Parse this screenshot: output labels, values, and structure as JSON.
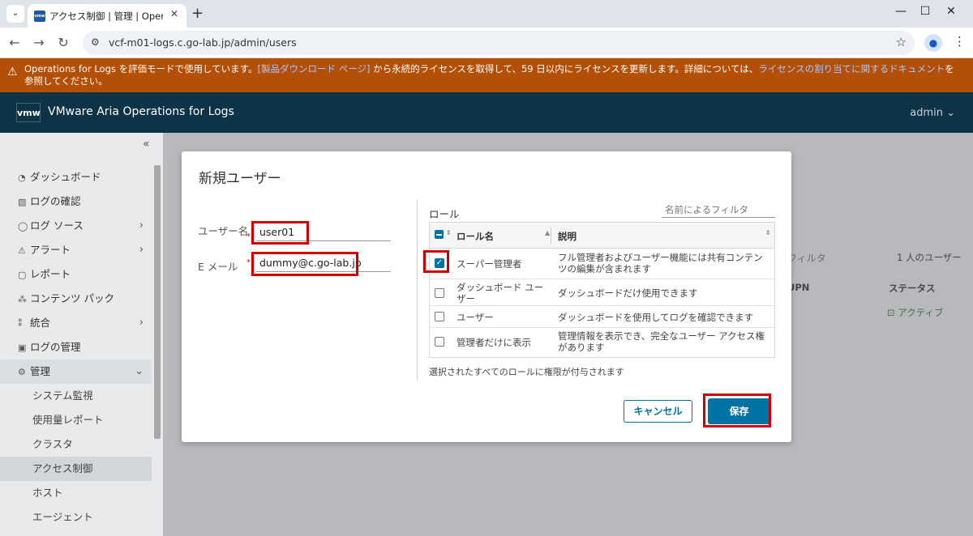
{
  "browser": {
    "tab_title": "アクセス制御 | 管理 | Operations",
    "tab_favicon": "vmw",
    "url": "vcf-m01-logs.c.go-lab.jp/admin/users"
  },
  "banner": {
    "text_1": "Operations for Logs を評価モードで使用しています。",
    "link_1": "[製品ダウンロード ページ]",
    "text_2": " から永続的ライセンスを取得して、59 日以内にライセンスを更新します。詳細については、",
    "link_2": "ライセンスの割り当てに関するドキュメント",
    "text_3": "を参照してください。"
  },
  "header": {
    "logo": "vmw",
    "title": "VMware Aria Operations for Logs",
    "user": "admin"
  },
  "sidebar": {
    "items": [
      {
        "label": "ダッシュボード",
        "icon": "dashboard-icon"
      },
      {
        "label": "ログの確認",
        "icon": "log-icon"
      },
      {
        "label": "ログ ソース",
        "icon": "source-icon"
      },
      {
        "label": "アラート",
        "icon": "alert-icon"
      },
      {
        "label": "レポート",
        "icon": "report-icon"
      },
      {
        "label": "コンテンツ パック",
        "icon": "content-pack-icon"
      },
      {
        "label": "統合",
        "icon": "integration-icon"
      },
      {
        "label": "ログの管理",
        "icon": "log-management-icon"
      },
      {
        "label": "管理",
        "icon": "gear-icon"
      }
    ],
    "subitems": [
      "システム監視",
      "使用量レポート",
      "クラスタ",
      "アクセス制御",
      "ホスト",
      "エージェント"
    ]
  },
  "background": {
    "filter_placeholder": "フィルタ",
    "user_count": "1 人のユーザー",
    "col_upn": "UPN",
    "col_status": "ステータス",
    "status_value": "アクティブ"
  },
  "modal": {
    "title": "新規ユーザー",
    "username_label": "ユーザー名",
    "username_value": "user01",
    "email_label": "E メール",
    "email_value": "dummy@c.go-lab.jp",
    "roles_label": "ロール",
    "role_filter_placeholder": "名前によるフィルタ",
    "col_role_name": "ロール名",
    "col_description": "説明",
    "roles": [
      {
        "name": "スーパー管理者",
        "description": "フル管理者およびユーザー機能には共有コンテンツの編集が含まれます",
        "checked": true
      },
      {
        "name": "ダッシュボード ユーザー",
        "description": "ダッシュボードだけ使用できます",
        "checked": false
      },
      {
        "name": "ユーザー",
        "description": "ダッシュボードを使用してログを確認できます",
        "checked": false
      },
      {
        "name": "管理者だけに表示",
        "description": "管理情報を表示でき、完全なユーザー アクセス権があります",
        "checked": false
      }
    ],
    "roles_note": "選択されたすべてのロールに権限が付与されます",
    "cancel_label": "キャンセル",
    "save_label": "保存"
  },
  "colors": {
    "banner": "#b34f06",
    "header": "#0d3347",
    "primary": "#0072a3",
    "highlight": "#d10000"
  }
}
